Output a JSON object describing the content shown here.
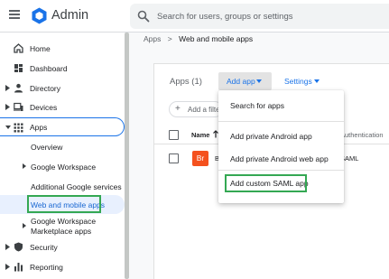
{
  "header": {
    "app_title": "Admin",
    "search_placeholder": "Search for users, groups or settings"
  },
  "sidebar": {
    "items": [
      {
        "label": "Home",
        "icon": "home-icon"
      },
      {
        "label": "Dashboard",
        "icon": "dashboard-icon"
      },
      {
        "label": "Directory",
        "icon": "person-icon"
      },
      {
        "label": "Devices",
        "icon": "devices-icon"
      },
      {
        "label": "Apps",
        "icon": "apps-grid-icon"
      }
    ],
    "apps_children": [
      {
        "label": "Overview"
      },
      {
        "label": "Google Workspace"
      },
      {
        "label": "Additional Google services"
      },
      {
        "label": "Web and mobile apps"
      },
      {
        "label": "Google Workspace"
      },
      {
        "label": "Marketplace apps"
      }
    ],
    "bottom_items": [
      {
        "label": "Security",
        "icon": "shield-icon"
      },
      {
        "label": "Reporting",
        "icon": "bar-chart-icon"
      }
    ]
  },
  "breadcrumb": {
    "root": "Apps",
    "separator": ">",
    "current": "Web and mobile apps"
  },
  "main": {
    "apps_count": "Apps (1)",
    "add_app_label": "Add app",
    "settings_label": "Settings",
    "filter_label": "Add a filter",
    "table": {
      "col_name": "Name",
      "col_auth": "Authentication",
      "row_badge": "Br",
      "row_name_peek": "B",
      "row_auth": "SAML"
    }
  },
  "dropdown": {
    "items": [
      {
        "label": "Search for apps"
      },
      {
        "label": "Add private Android app"
      },
      {
        "label": "Add private Android web app"
      },
      {
        "label": "Add custom SAML app"
      }
    ]
  },
  "colors": {
    "accent": "#1a73e8",
    "highlight_box": "#34a853",
    "selected_bg": "#e8f0fe",
    "badge": "#f4511e"
  }
}
